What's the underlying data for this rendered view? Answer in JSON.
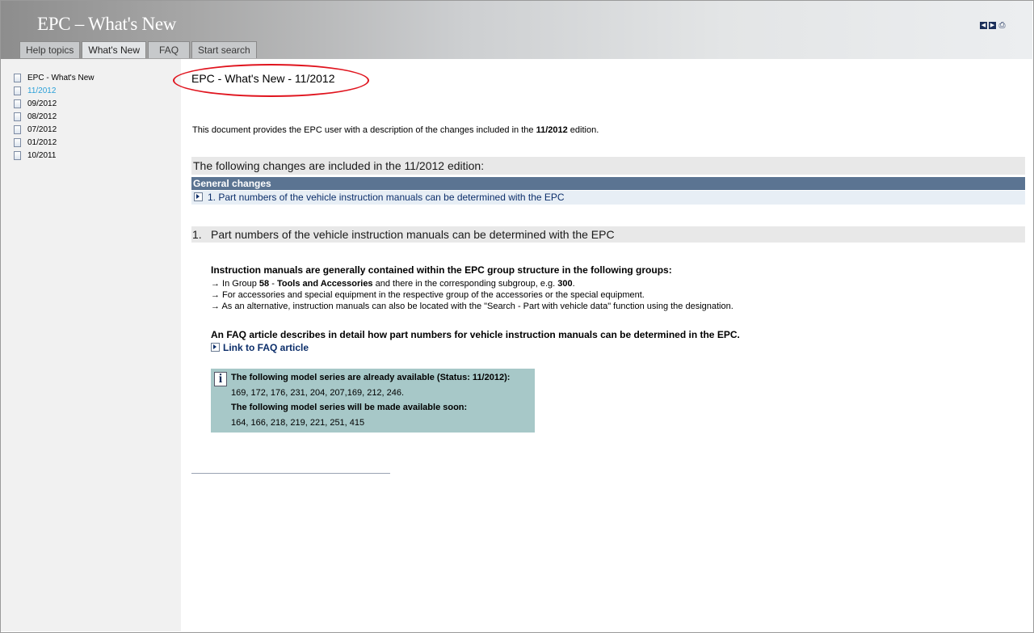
{
  "app": {
    "title": "EPC – What's New"
  },
  "tabs": [
    {
      "label": "Help topics",
      "active": false
    },
    {
      "label": "What's New",
      "active": true
    },
    {
      "label": "FAQ",
      "active": false
    },
    {
      "label": "Start search",
      "active": false
    }
  ],
  "header_icons": [
    "prev-icon",
    "next-icon",
    "print-icon"
  ],
  "sidebar": {
    "items": [
      {
        "label": "EPC - What's New"
      },
      {
        "label": "11/2012",
        "active": true
      },
      {
        "label": "09/2012"
      },
      {
        "label": "08/2012"
      },
      {
        "label": "07/2012"
      },
      {
        "label": "01/2012"
      },
      {
        "label": "10/2011"
      }
    ]
  },
  "content": {
    "title": "EPC - What's New - 11/2012",
    "intro_pre": "This document provides the EPC user with a description of the changes included in the ",
    "intro_bold": "11/2012",
    "intro_post": " edition.",
    "changes_heading": "The following changes are included in the 11/2012 edition:",
    "general_changes_label": "General changes",
    "general_changes_item": "1. Part numbers of the vehicle instruction manuals can be determined with the EPC",
    "section_number": "1.",
    "section_title": "Part numbers of the vehicle instruction manuals can be determined with the EPC",
    "groups_intro": "Instruction manuals are generally contained within the EPC group structure in the following groups:",
    "bullet1_pre": "→ In Group ",
    "bullet1_group": "58",
    "bullet1_mid": " - ",
    "bullet1_name": "Tools and Accessories",
    "bullet1_post": " and there in the corresponding subgroup, e.g. ",
    "bullet1_sub": "300",
    "bullet1_end": ".",
    "bullet2": "→ For accessories and special equipment in the respective group of the accessories or the special equipment.",
    "bullet3": "→ As an alternative, instruction manuals can also be located with the \"Search - Part with vehicle data\" function using the designation.",
    "faq_text": "An FAQ article describes in detail how part numbers for vehicle instruction manuals can be determined in the EPC.",
    "faq_link": "Link to FAQ article",
    "info": {
      "available_label": "The following model series are already available (Status: 11/2012):",
      "available_values": "169, 172, 176, 231, 204, 207,169, 212, 246.",
      "soon_label": "The following model series will be made available soon:",
      "soon_values": "164, 166, 218, 219, 221, 251, 415"
    }
  },
  "colors": {
    "header_dark": "#8d8d8d",
    "header_light": "#eceef0",
    "section_bar": "#5b7492",
    "link": "#0c2e6a",
    "info_box": "#a7c8c8",
    "annotation": "#e0141e",
    "active_nav": "#2aa0d8"
  }
}
